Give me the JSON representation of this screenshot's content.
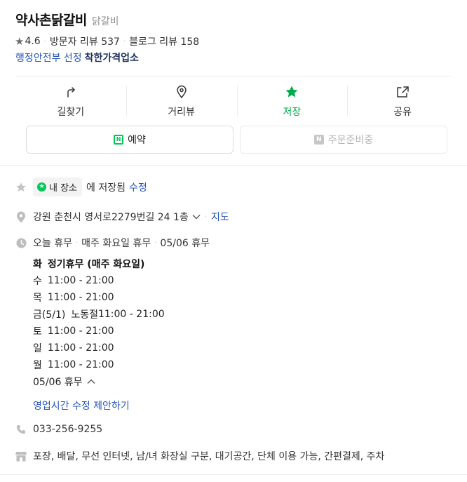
{
  "place": {
    "name": "약사촌닭갈비",
    "category": "닭갈비",
    "rating": "4.6",
    "visitor_reviews": "방문자 리뷰 537",
    "blog_reviews": "블로그 리뷰 158",
    "gov_label": "행정안전부 선정",
    "gov_badge": "착한가격업소"
  },
  "actions": [
    {
      "label": "길찾기",
      "icon": "directions-icon"
    },
    {
      "label": "거리뷰",
      "icon": "location-pin-icon"
    },
    {
      "label": "저장",
      "icon": "star-icon",
      "active": true
    },
    {
      "label": "공유",
      "icon": "share-icon"
    }
  ],
  "buttons": {
    "reserve": "예약",
    "order": "주문준비중",
    "reserve_icon": "N",
    "order_icon": "N"
  },
  "saved": {
    "chip_label": "내 장소",
    "text": "에 저장됨",
    "edit": "수정"
  },
  "address": {
    "text": "강원 춘천시 영서로2279번길 24 1층",
    "map_link": "지도"
  },
  "hours": {
    "today": "오늘 휴무",
    "weekly": "매주 화요일 휴무",
    "date": "05/06 휴무",
    "rows": [
      {
        "day": "화",
        "time": "정기휴무 (매주 화요일)",
        "bold": true
      },
      {
        "day": "수",
        "time": "11:00 - 21:00"
      },
      {
        "day": "목",
        "time": "11:00 - 21:00"
      },
      {
        "day": "금(5/1)",
        "note": "노동절",
        "time": "11:00 - 21:00"
      },
      {
        "day": "토",
        "time": "11:00 - 21:00"
      },
      {
        "day": "일",
        "time": "11:00 - 21:00"
      },
      {
        "day": "월",
        "time": "11:00 - 21:00"
      }
    ],
    "holiday_row": "05/06 휴무",
    "suggest_link": "영업시간 수정 제안하기"
  },
  "phone": "033-256-9255",
  "facilities": "포장, 배달, 무선 인터넷, 남/녀 화장실 구분, 대기공간, 단체 이용 가능, 간편결제, 주차",
  "colors": {
    "accent_green": "#03c75a",
    "link_blue": "#2556b8",
    "badge_navy": "#1c2e5e"
  }
}
